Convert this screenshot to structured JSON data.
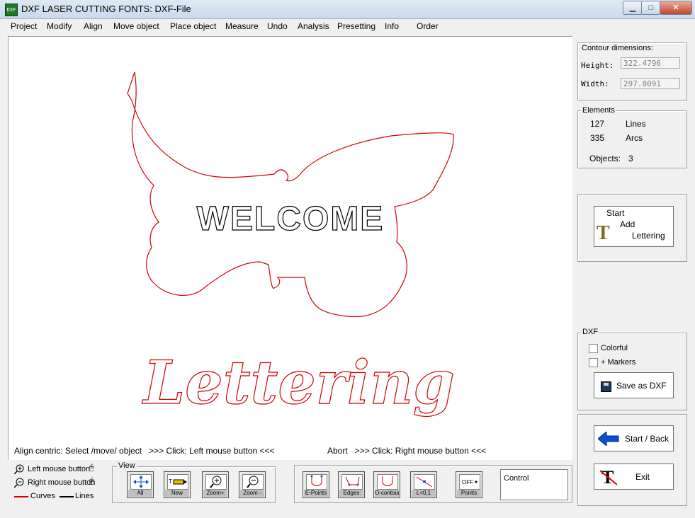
{
  "window": {
    "title": "DXF LASER CUTTING FONTS: DXF-File",
    "app_icon": "DXF"
  },
  "menu": [
    "Project",
    "Modify",
    "Align",
    "Move object",
    "Place object",
    "Measure",
    "Undo",
    "Analysis",
    "Presetting",
    "Info",
    "Order"
  ],
  "drawing": {
    "word1": "WELCOME",
    "word2": "Lettering"
  },
  "status": {
    "left": "Align centric: Select /move/ object   >>> Click: Left mouse button <<<",
    "right": "Abort   >>> Click: Right mouse button <<<"
  },
  "contour": {
    "title": "Contour dimensions:",
    "height_label": "Height:",
    "height_value": "322.4796",
    "width_label": "Width:",
    "width_value": "297.8091"
  },
  "elements": {
    "title": "Elements",
    "lines_count": "127",
    "lines_label": "Lines",
    "arcs_count": "335",
    "arcs_label": "Arcs",
    "objects_label": "Objects:",
    "objects_count": "3"
  },
  "lettering_button": {
    "line1": "Start",
    "line2": "Add",
    "line3": "Lettering"
  },
  "dxf": {
    "title": "DXF",
    "colorful": "Colorful",
    "markers": "+ Markers",
    "save": "Save as DXF"
  },
  "nav": {
    "start_back": "Start / Back",
    "exit": "Exit"
  },
  "legend": {
    "left_mouse": "Left mouse button",
    "right_mouse": "Right mouse button",
    "curves": "Curves",
    "lines": "Lines"
  },
  "view": {
    "title": "View",
    "buttons": [
      "All",
      "New",
      "Zoom+",
      "Zoom -"
    ]
  },
  "tools": [
    "E-Points",
    "Edges",
    "O-contour",
    "L<0,1",
    "Points"
  ],
  "control": {
    "label": "Control"
  },
  "colors": {
    "curve": "#d40000",
    "line": "#000000",
    "accent": "#0a4fd0"
  }
}
